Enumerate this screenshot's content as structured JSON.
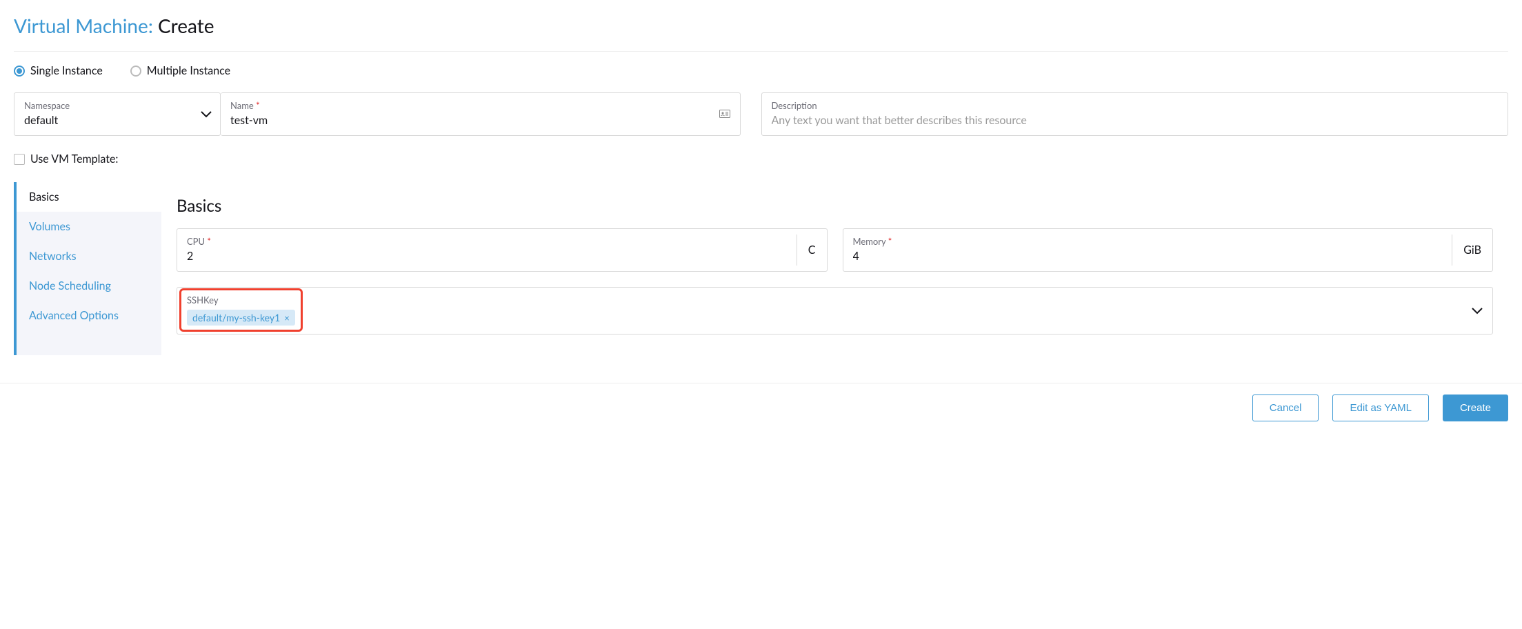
{
  "title": {
    "prefix": "Virtual Machine: ",
    "action": "Create"
  },
  "instance_options": {
    "single": "Single Instance",
    "multiple": "Multiple Instance"
  },
  "fields": {
    "namespace": {
      "label": "Namespace",
      "value": "default"
    },
    "name": {
      "label": "Name",
      "value": "test-vm"
    },
    "description": {
      "label": "Description",
      "placeholder": "Any text you want that better describes this resource"
    }
  },
  "template_checkbox": "Use VM Template:",
  "tabs": {
    "basics": "Basics",
    "volumes": "Volumes",
    "networks": "Networks",
    "node_scheduling": "Node Scheduling",
    "advanced_options": "Advanced Options"
  },
  "basics": {
    "heading": "Basics",
    "cpu": {
      "label": "CPU",
      "value": "2",
      "unit": "C"
    },
    "memory": {
      "label": "Memory",
      "value": "4",
      "unit": "GiB"
    },
    "sshkey": {
      "label": "SSHKey",
      "token": "default/my-ssh-key1",
      "token_close": "×"
    }
  },
  "footer": {
    "cancel": "Cancel",
    "edit_yaml": "Edit as YAML",
    "create": "Create"
  }
}
